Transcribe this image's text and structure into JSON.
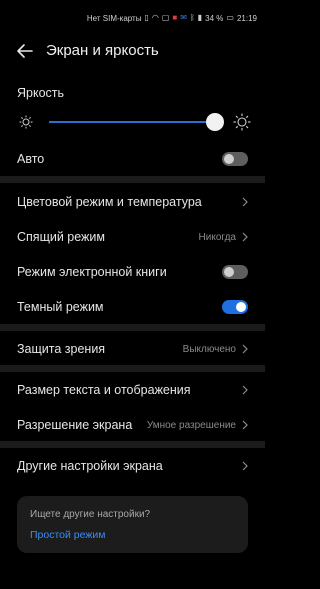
{
  "status": {
    "carrier": "Нет SIM-карты",
    "battery": "34 %",
    "time": "21:19"
  },
  "header": {
    "title": "Экран и яркость"
  },
  "brightness": {
    "label": "Яркость",
    "level": 0.93
  },
  "auto": {
    "label": "Авто",
    "on": false
  },
  "items": {
    "color_mode": {
      "label": "Цветовой режим и температура"
    },
    "sleep": {
      "label": "Спящий режим",
      "value": "Никогда"
    },
    "ebook": {
      "label": "Режим электронной книги",
      "on": false
    },
    "dark": {
      "label": "Темный режим",
      "on": true
    },
    "eye": {
      "label": "Защита зрения",
      "value": "Выключено"
    },
    "text_size": {
      "label": "Размер текста и отображения"
    },
    "resolution": {
      "label": "Разрешение экрана",
      "value": "Умное разрешение"
    },
    "other": {
      "label": "Другие настройки экрана"
    }
  },
  "card": {
    "question": "Ищете другие настройки?",
    "link": "Простой режим"
  },
  "colors": {
    "accent": "#1f6fe0",
    "link": "#3d8bf2",
    "background": "#000000"
  }
}
